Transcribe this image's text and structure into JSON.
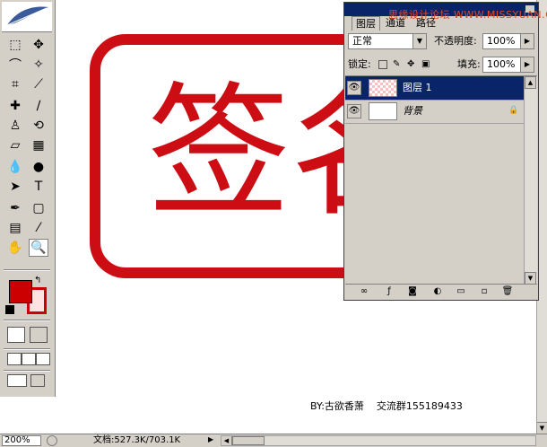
{
  "toolbox": {
    "tools": [
      {
        "icon": "marquee-icon",
        "glyph": "⬚"
      },
      {
        "icon": "move-icon",
        "glyph": "✥"
      },
      {
        "icon": "lasso-icon",
        "glyph": "⌒"
      },
      {
        "icon": "magic-wand-icon",
        "glyph": "✧"
      },
      {
        "icon": "crop-icon",
        "glyph": "⌗"
      },
      {
        "icon": "slice-icon",
        "glyph": "⟋"
      },
      {
        "icon": "healing-brush-icon",
        "glyph": "✚"
      },
      {
        "icon": "brush-icon",
        "glyph": "∕"
      },
      {
        "icon": "clone-stamp-icon",
        "glyph": "♙"
      },
      {
        "icon": "history-brush-icon",
        "glyph": "⟲"
      },
      {
        "icon": "eraser-icon",
        "glyph": "▱"
      },
      {
        "icon": "gradient-icon",
        "glyph": "▦"
      },
      {
        "icon": "blur-icon",
        "glyph": "💧"
      },
      {
        "icon": "dodge-icon",
        "glyph": "●"
      },
      {
        "icon": "path-select-icon",
        "glyph": "➤"
      },
      {
        "icon": "type-icon",
        "glyph": "T"
      },
      {
        "icon": "pen-icon",
        "glyph": "✒"
      },
      {
        "icon": "shape-icon",
        "glyph": "▢"
      },
      {
        "icon": "notes-icon",
        "glyph": "▤"
      },
      {
        "icon": "eyedropper-icon",
        "glyph": "⁄"
      },
      {
        "icon": "hand-icon",
        "glyph": "✋"
      },
      {
        "icon": "zoom-icon",
        "glyph": "🔍"
      }
    ],
    "foreground_color": "#cc0000",
    "background_color": "#ffe3e3"
  },
  "canvas": {
    "stamp_text": "签名",
    "stamp_color": "#cc0d13",
    "credit_by": "BY:古欲香萧",
    "credit_group": "交流群155189433"
  },
  "layers_panel": {
    "tabs": [
      "图层",
      "通道",
      "路径"
    ],
    "watermark": "思缘设计论坛  WWW.MISSYUAN.COM",
    "blend_mode": "正常",
    "opacity_label": "不透明度:",
    "opacity_value": "100%",
    "lock_label": "锁定:",
    "fill_label": "填充:",
    "fill_value": "100%",
    "layers": [
      {
        "name": "图层 1",
        "selected": true,
        "italic": false,
        "locked": false
      },
      {
        "name": "背景",
        "selected": false,
        "italic": true,
        "locked": true
      }
    ]
  },
  "status": {
    "zoom": "200%",
    "doc_info": "文档:527.3K/703.1K"
  }
}
